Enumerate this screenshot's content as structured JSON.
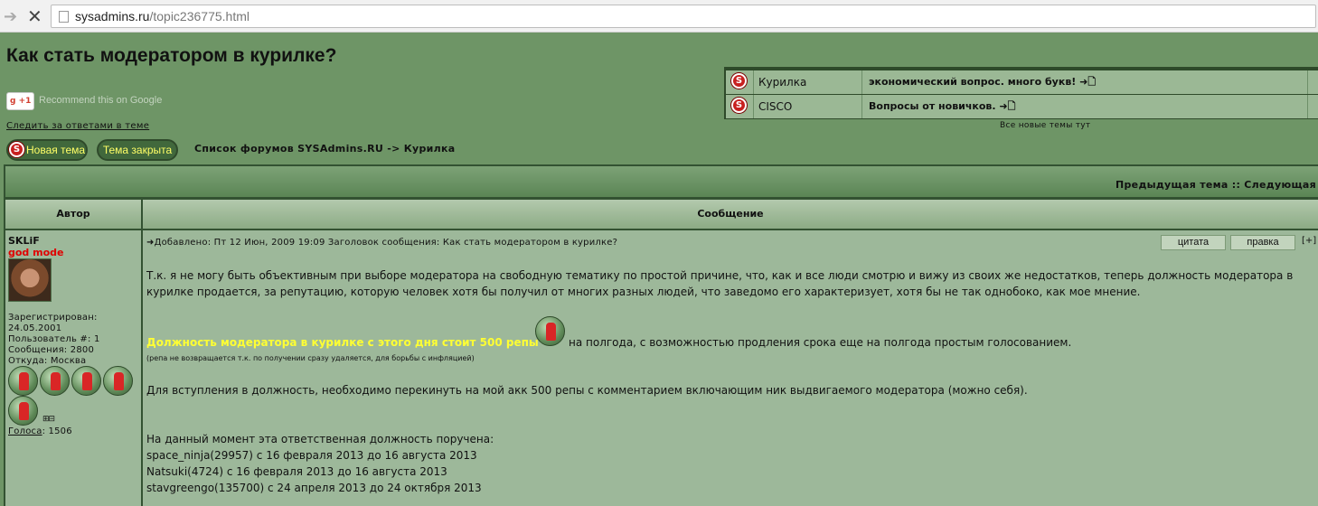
{
  "browser": {
    "url_host": "sysadmins.ru",
    "url_path": "/topic236775.html"
  },
  "page": {
    "title": "Как стать модератором в курилке?",
    "gplus_label": "+1",
    "gplus_text": "Recommend this on Google",
    "follow_link": "Следить за ответами в теме",
    "new_topic_button": "Новая тема",
    "topic_closed_button": "Тема закрыта",
    "breadcrumb": "Список форумов SYSAdmins.RU -> Курилка"
  },
  "recent": {
    "rows": [
      {
        "category": "Курилка",
        "topic": "экономический вопрос. много букв! ➜🗋"
      },
      {
        "category": "CISCO",
        "topic": "Вопросы от новичков. ➜🗋"
      }
    ],
    "all_new_link": "Все новые темы тут"
  },
  "thread": {
    "nav_links": "Предыдущая тема :: Следующая",
    "header_author": "Автор",
    "header_message": "Сообщение"
  },
  "author": {
    "name": "SKLiF",
    "rank": "god mode",
    "registered_label": "Зарегистрирован:",
    "registered_date": "24.05.2001",
    "user_no": "Пользователь #: 1",
    "posts": "Сообщения: 2800",
    "location": "Откуда: Москва",
    "plusminus": "⊞⊟",
    "votes_label": "Голоса",
    "votes_value": ": 1506",
    "reputation_icon_count": 5
  },
  "post": {
    "posted": "➜Добавлено: Пт 12 Июн, 2009 19:09    Заголовок сообщения: Как стать модератором в курилке?",
    "quote_button": "цитата",
    "edit_button": "правка",
    "expand": "[+]",
    "para1": "Т.к. я не могу быть объективным при выборе модератора на свободную тематику по простой причине, что, как и все люди смотрю и вижу из своих же недостатков, теперь должность модератора в курилке продается, за репутацию, которую человек хотя бы получил от многих разных людей, что заведомо его характеризует, хотя бы не так однобоко, как мое мнение.",
    "highlight": "Должность модератора в курилке с этого дня стоит 500 репы",
    "highlight_rest": "на полгода, с возможностью продления срока еще на полгода простым голосованием.",
    "small_note": "(репа не возвращается т.к. по получении сразу удаляется, для борьбы с инфляцией)",
    "para3": "Для вступления в должность, необходимо перекинуть на мой акк 500 репы с комментарием включающим ник выдвигаемого модератора (можно себя).",
    "para4": "На данный момент эта ответственная должность поручена:",
    "line1": "space_ninja(29957) с 16 февраля 2013 до 16 августа 2013",
    "line2": "Natsuki(4724) с 16 февраля 2013 до 16 августа 2013",
    "line3": "stavgreengo(135700) с 24 апреля 2013 до 24 октября 2013"
  },
  "colors": {
    "page_bg": "#6e9566",
    "cell_bg": "#9db89a",
    "highlight": "#ffff33",
    "rank": "#e00000"
  }
}
